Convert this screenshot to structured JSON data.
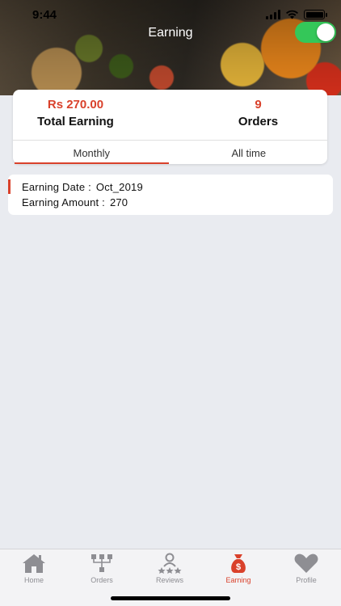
{
  "status_bar": {
    "time": "9:44"
  },
  "header": {
    "title": "Earning",
    "toggle_on": true
  },
  "summary": {
    "total_earning_value": "Rs 270.00",
    "total_earning_label": "Total Earning",
    "orders_value": "9",
    "orders_label": "Orders"
  },
  "tabs": [
    {
      "label": "Monthly",
      "active": true
    },
    {
      "label": "All time",
      "active": false
    }
  ],
  "record": {
    "date_label": "Earning Date :",
    "date_value": "Oct_2019",
    "amount_label": "Earning Amount :",
    "amount_value": "270"
  },
  "tabbar": [
    {
      "label": "Home",
      "icon": "home-icon",
      "active": false
    },
    {
      "label": "Orders",
      "icon": "orders-icon",
      "active": false
    },
    {
      "label": "Reviews",
      "icon": "reviews-icon",
      "active": false
    },
    {
      "label": "Earning",
      "icon": "money-bag-icon",
      "active": true
    },
    {
      "label": "Profile",
      "icon": "heart-icon",
      "active": false
    }
  ],
  "colors": {
    "accent": "#d9412b",
    "toggle_on": "#34c759",
    "background": "#e9ebf0",
    "tab_inactive": "#8e8e93"
  }
}
